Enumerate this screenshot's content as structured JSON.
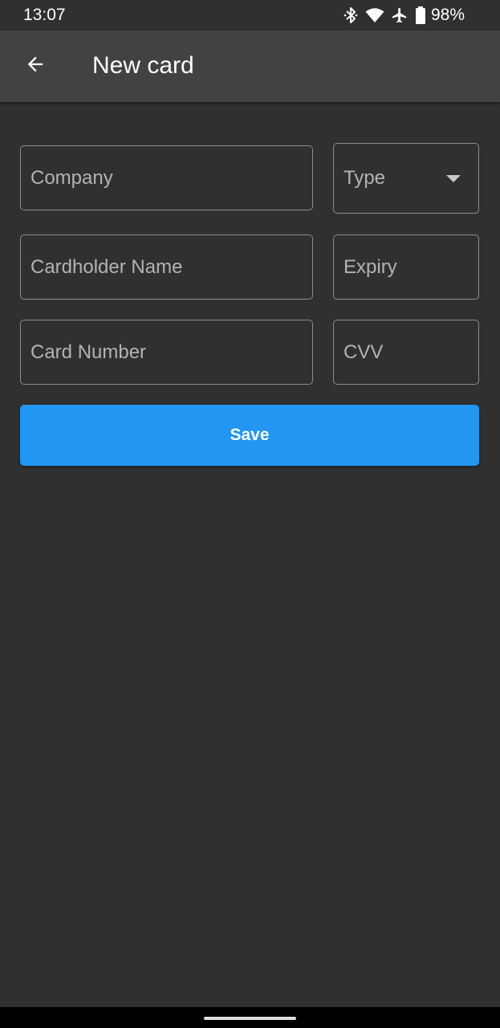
{
  "status_bar": {
    "time": "13:07",
    "battery_percent": "98%",
    "icons": [
      "bluetooth-icon",
      "wifi-icon",
      "airplane-icon",
      "battery-icon"
    ]
  },
  "app_bar": {
    "title": "New card",
    "back_icon": "arrow-left-icon"
  },
  "form": {
    "company": {
      "placeholder": "Company",
      "value": ""
    },
    "type": {
      "label": "Type",
      "icon": "dropdown-arrow-icon"
    },
    "cardholder_name": {
      "placeholder": "Cardholder Name",
      "value": ""
    },
    "expiry": {
      "placeholder": "Expiry",
      "value": ""
    },
    "card_number": {
      "placeholder": "Card Number",
      "value": ""
    },
    "cvv": {
      "placeholder": "CVV",
      "value": ""
    },
    "save_label": "Save"
  },
  "colors": {
    "background": "#303030",
    "app_bar": "#424242",
    "accent": "#2196f3",
    "field_border": "#8c8c8c",
    "placeholder": "#b3b3b3"
  }
}
